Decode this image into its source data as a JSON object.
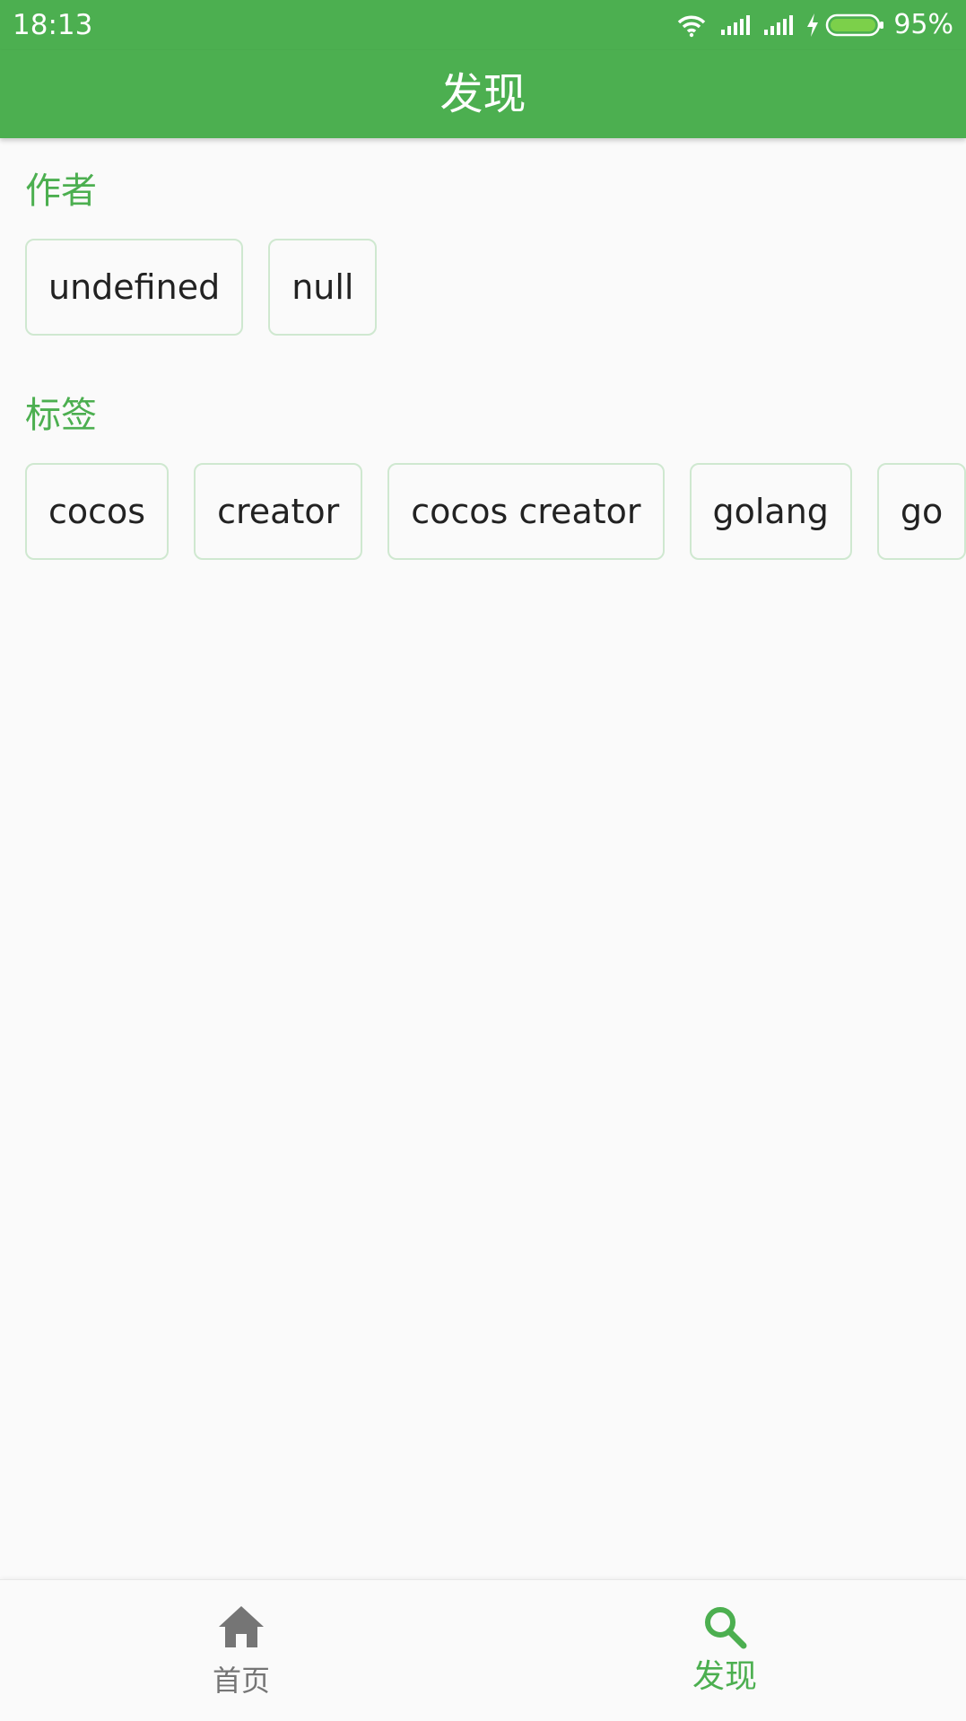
{
  "status_bar": {
    "time": "18:13",
    "battery_percent": "95%",
    "icons": [
      "wifi-icon",
      "signal-icon",
      "signal-icon",
      "charging-icon",
      "battery-icon"
    ]
  },
  "app_bar": {
    "title": "发现"
  },
  "sections": {
    "authors": {
      "title": "作者",
      "chips": [
        "undefined",
        "null"
      ]
    },
    "tags": {
      "title": "标签",
      "chips": [
        "cocos",
        "creator",
        "cocos creator",
        "golang",
        "go"
      ]
    }
  },
  "bottom_nav": {
    "items": [
      {
        "label": "首页",
        "icon": "home-icon",
        "active": false
      },
      {
        "label": "发现",
        "icon": "search-icon",
        "active": true
      }
    ]
  },
  "colors": {
    "primary": "#4caf50",
    "background": "#fafafa",
    "chip_border": "#cfe8d0",
    "chip_text": "#222222",
    "nav_inactive": "#757575"
  }
}
